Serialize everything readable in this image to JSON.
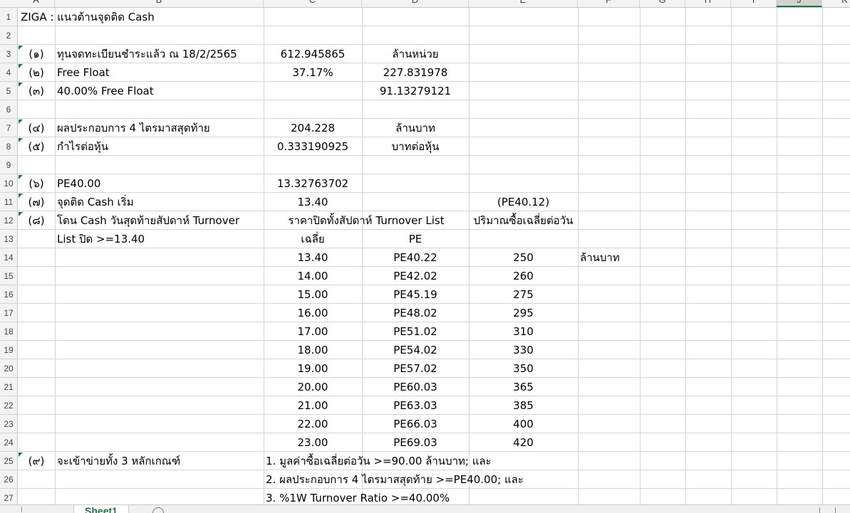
{
  "column_headers": [
    "A",
    "B",
    "C",
    "D",
    "E",
    "F",
    "G",
    "H",
    "I",
    "J",
    "K"
  ],
  "row_numbers": [
    "1",
    "2",
    "3",
    "4",
    "5",
    "6",
    "7",
    "8",
    "9",
    "10",
    "11",
    "12",
    "13",
    "14",
    "15",
    "16",
    "17",
    "18",
    "19",
    "20",
    "21",
    "22",
    "23",
    "24",
    "25",
    "26",
    "27"
  ],
  "rows": {
    "r1": {
      "a": "ZIGA  :  แนวต้านจุดติด Cash"
    },
    "r3": {
      "a": "(๑)",
      "b": "ทุนจดทะเบียนชำระแล้ว ณ 18/2/2565",
      "c": "612.945865",
      "d": "ล้านหน่วย"
    },
    "r4": {
      "a": "(๒)",
      "b": "Free Float",
      "c": "37.17%",
      "d": "227.831978"
    },
    "r5": {
      "a": "(๓)",
      "b": "40.00% Free Float",
      "d": "91.13279121"
    },
    "r7": {
      "a": "(๔)",
      "b": "ผลประกอบการ 4 ไตรมาสสุดท้าย",
      "c": "204.228",
      "d": "ล้านบาท"
    },
    "r8": {
      "a": "(๕)",
      "b": "กำไรต่อหุ้น",
      "c": "0.333190925",
      "d": "บาทต่อหุ้น"
    },
    "r10": {
      "a": "(๖)",
      "b": "PE40.00",
      "c": "13.32763702"
    },
    "r11": {
      "a": "(๗)",
      "b": "จุดติด Cash เริ่ม",
      "c": "13.40",
      "e": "(PE40.12)"
    },
    "r12": {
      "a": "(๘)",
      "b": "โดน Cash วันสุดท้ายสัปดาห์ Turnover",
      "cd": "ราคาปิดทั้งสัปดาห์ Turnover List",
      "e": "ปริมาณซื้อเฉลี่ยต่อวัน"
    },
    "r13": {
      "b": "List ปิด >=13.40",
      "c": "เฉลี่ย",
      "d": "PE"
    },
    "r25": {
      "a": "(๙)",
      "b": "จะเข้าข่ายทั้ง 3 หลักเกณฑ์",
      "c": "1.  มูลค่าซื้อเฉลี่ยต่อวัน >=90.00 ล้านบาท; และ"
    },
    "r26": {
      "c": "2.  ผลประกอบการ 4 ไตรมาสสุดท้าย >=PE40.00; และ"
    },
    "r27": {
      "c": "3.  %1W Turnover Ratio >=40.00%"
    }
  },
  "unit_note": "ล้านบาท",
  "table": [
    {
      "price": "13.40",
      "pe": "PE40.22",
      "volume": "250"
    },
    {
      "price": "14.00",
      "pe": "PE42.02",
      "volume": "260"
    },
    {
      "price": "15.00",
      "pe": "PE45.19",
      "volume": "275"
    },
    {
      "price": "16.00",
      "pe": "PE48.02",
      "volume": "295"
    },
    {
      "price": "17.00",
      "pe": "PE51.02",
      "volume": "310"
    },
    {
      "price": "18.00",
      "pe": "PE54.02",
      "volume": "330"
    },
    {
      "price": "19.00",
      "pe": "PE57.02",
      "volume": "350"
    },
    {
      "price": "20.00",
      "pe": "PE60.03",
      "volume": "365"
    },
    {
      "price": "21.00",
      "pe": "PE63.03",
      "volume": "385"
    },
    {
      "price": "22.00",
      "pe": "PE66.03",
      "volume": "400"
    },
    {
      "price": "23.00",
      "pe": "PE69.03",
      "volume": "420"
    }
  ],
  "sheet_tab": "Sheet1",
  "colors": {
    "accent": "#217346",
    "gridline": "#d4d4d4",
    "header_bg": "#f3f3f3",
    "comment_marker": "#1e7a3a"
  }
}
